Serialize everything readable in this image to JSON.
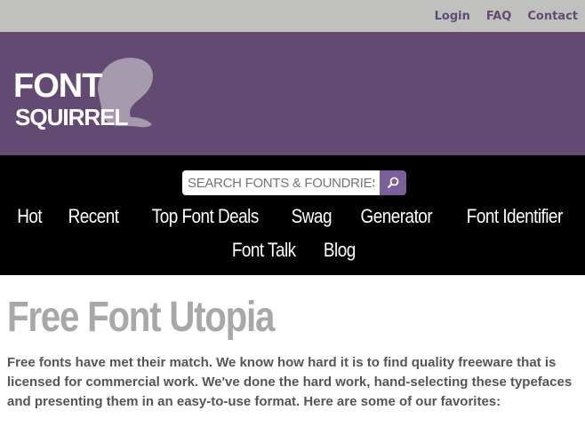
{
  "topnav": {
    "login": "Login",
    "faq": "FAQ",
    "contact": "Contact"
  },
  "logo": {
    "line1": "FONT",
    "line2": "SQUIRREL"
  },
  "search": {
    "placeholder": "SEARCH FONTS & FOUNDRIES",
    "icon": "search-icon"
  },
  "nav": {
    "row1": [
      "Hot",
      "Recent",
      "Top Font Deals",
      "Swag",
      "Generator",
      "Font Identifier"
    ],
    "row2": [
      "Font Talk",
      "Blog"
    ]
  },
  "main": {
    "title": "Free Font Utopia",
    "intro": "Free fonts have met their match. We know how hard it is to find quality freeware that is licensed for commercial work. We've done the hard work, hand-selecting these typefaces and presenting them in an easy-to-use format. Here are some of our favorites:"
  },
  "colors": {
    "banner": "#634a72",
    "topbar": "#c0c0be",
    "nav": "#000000",
    "accent": "#7a609a"
  }
}
